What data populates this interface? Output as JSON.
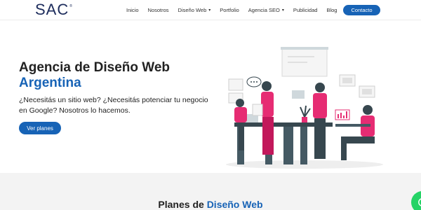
{
  "header": {
    "logo": "SAC",
    "nav": [
      {
        "label": "Inicio"
      },
      {
        "label": "Nosotros"
      },
      {
        "label": "Diseño Web",
        "dropdown": true
      },
      {
        "label": "Portfolio"
      },
      {
        "label": "Agencia SEO",
        "dropdown": true
      },
      {
        "label": "Publicidad"
      },
      {
        "label": "Blog"
      }
    ],
    "contact_label": "Contacto"
  },
  "hero": {
    "title_line1": "Agencia de Diseño Web",
    "title_line2": "Argentina",
    "description": "¿Necesitás un sitio web? ¿Necesitás potenciar tu negocio en Google? Nosotros lo hacemos.",
    "button_label": "Ver planes"
  },
  "plans": {
    "title_prefix": "Planes de",
    "title_highlight": "Diseño Web"
  },
  "colors": {
    "primary": "#1763b6",
    "accent_pink": "#e62c73",
    "dark_gray": "#37474f",
    "whatsapp": "#25d366"
  },
  "icons": [
    "chevron-down-icon",
    "whatsapp-icon"
  ]
}
